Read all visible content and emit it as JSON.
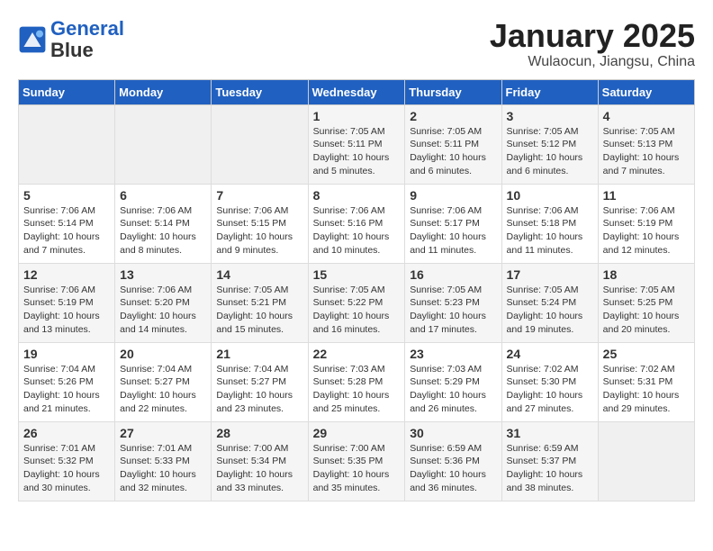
{
  "header": {
    "logo_line1": "General",
    "logo_line2": "Blue",
    "month": "January 2025",
    "location": "Wulaocun, Jiangsu, China"
  },
  "days_of_week": [
    "Sunday",
    "Monday",
    "Tuesday",
    "Wednesday",
    "Thursday",
    "Friday",
    "Saturday"
  ],
  "weeks": [
    [
      {
        "num": "",
        "info": ""
      },
      {
        "num": "",
        "info": ""
      },
      {
        "num": "",
        "info": ""
      },
      {
        "num": "1",
        "info": "Sunrise: 7:05 AM\nSunset: 5:11 PM\nDaylight: 10 hours\nand 5 minutes."
      },
      {
        "num": "2",
        "info": "Sunrise: 7:05 AM\nSunset: 5:11 PM\nDaylight: 10 hours\nand 6 minutes."
      },
      {
        "num": "3",
        "info": "Sunrise: 7:05 AM\nSunset: 5:12 PM\nDaylight: 10 hours\nand 6 minutes."
      },
      {
        "num": "4",
        "info": "Sunrise: 7:05 AM\nSunset: 5:13 PM\nDaylight: 10 hours\nand 7 minutes."
      }
    ],
    [
      {
        "num": "5",
        "info": "Sunrise: 7:06 AM\nSunset: 5:14 PM\nDaylight: 10 hours\nand 7 minutes."
      },
      {
        "num": "6",
        "info": "Sunrise: 7:06 AM\nSunset: 5:14 PM\nDaylight: 10 hours\nand 8 minutes."
      },
      {
        "num": "7",
        "info": "Sunrise: 7:06 AM\nSunset: 5:15 PM\nDaylight: 10 hours\nand 9 minutes."
      },
      {
        "num": "8",
        "info": "Sunrise: 7:06 AM\nSunset: 5:16 PM\nDaylight: 10 hours\nand 10 minutes."
      },
      {
        "num": "9",
        "info": "Sunrise: 7:06 AM\nSunset: 5:17 PM\nDaylight: 10 hours\nand 11 minutes."
      },
      {
        "num": "10",
        "info": "Sunrise: 7:06 AM\nSunset: 5:18 PM\nDaylight: 10 hours\nand 11 minutes."
      },
      {
        "num": "11",
        "info": "Sunrise: 7:06 AM\nSunset: 5:19 PM\nDaylight: 10 hours\nand 12 minutes."
      }
    ],
    [
      {
        "num": "12",
        "info": "Sunrise: 7:06 AM\nSunset: 5:19 PM\nDaylight: 10 hours\nand 13 minutes."
      },
      {
        "num": "13",
        "info": "Sunrise: 7:06 AM\nSunset: 5:20 PM\nDaylight: 10 hours\nand 14 minutes."
      },
      {
        "num": "14",
        "info": "Sunrise: 7:05 AM\nSunset: 5:21 PM\nDaylight: 10 hours\nand 15 minutes."
      },
      {
        "num": "15",
        "info": "Sunrise: 7:05 AM\nSunset: 5:22 PM\nDaylight: 10 hours\nand 16 minutes."
      },
      {
        "num": "16",
        "info": "Sunrise: 7:05 AM\nSunset: 5:23 PM\nDaylight: 10 hours\nand 17 minutes."
      },
      {
        "num": "17",
        "info": "Sunrise: 7:05 AM\nSunset: 5:24 PM\nDaylight: 10 hours\nand 19 minutes."
      },
      {
        "num": "18",
        "info": "Sunrise: 7:05 AM\nSunset: 5:25 PM\nDaylight: 10 hours\nand 20 minutes."
      }
    ],
    [
      {
        "num": "19",
        "info": "Sunrise: 7:04 AM\nSunset: 5:26 PM\nDaylight: 10 hours\nand 21 minutes."
      },
      {
        "num": "20",
        "info": "Sunrise: 7:04 AM\nSunset: 5:27 PM\nDaylight: 10 hours\nand 22 minutes."
      },
      {
        "num": "21",
        "info": "Sunrise: 7:04 AM\nSunset: 5:27 PM\nDaylight: 10 hours\nand 23 minutes."
      },
      {
        "num": "22",
        "info": "Sunrise: 7:03 AM\nSunset: 5:28 PM\nDaylight: 10 hours\nand 25 minutes."
      },
      {
        "num": "23",
        "info": "Sunrise: 7:03 AM\nSunset: 5:29 PM\nDaylight: 10 hours\nand 26 minutes."
      },
      {
        "num": "24",
        "info": "Sunrise: 7:02 AM\nSunset: 5:30 PM\nDaylight: 10 hours\nand 27 minutes."
      },
      {
        "num": "25",
        "info": "Sunrise: 7:02 AM\nSunset: 5:31 PM\nDaylight: 10 hours\nand 29 minutes."
      }
    ],
    [
      {
        "num": "26",
        "info": "Sunrise: 7:01 AM\nSunset: 5:32 PM\nDaylight: 10 hours\nand 30 minutes."
      },
      {
        "num": "27",
        "info": "Sunrise: 7:01 AM\nSunset: 5:33 PM\nDaylight: 10 hours\nand 32 minutes."
      },
      {
        "num": "28",
        "info": "Sunrise: 7:00 AM\nSunset: 5:34 PM\nDaylight: 10 hours\nand 33 minutes."
      },
      {
        "num": "29",
        "info": "Sunrise: 7:00 AM\nSunset: 5:35 PM\nDaylight: 10 hours\nand 35 minutes."
      },
      {
        "num": "30",
        "info": "Sunrise: 6:59 AM\nSunset: 5:36 PM\nDaylight: 10 hours\nand 36 minutes."
      },
      {
        "num": "31",
        "info": "Sunrise: 6:59 AM\nSunset: 5:37 PM\nDaylight: 10 hours\nand 38 minutes."
      },
      {
        "num": "",
        "info": ""
      }
    ]
  ]
}
